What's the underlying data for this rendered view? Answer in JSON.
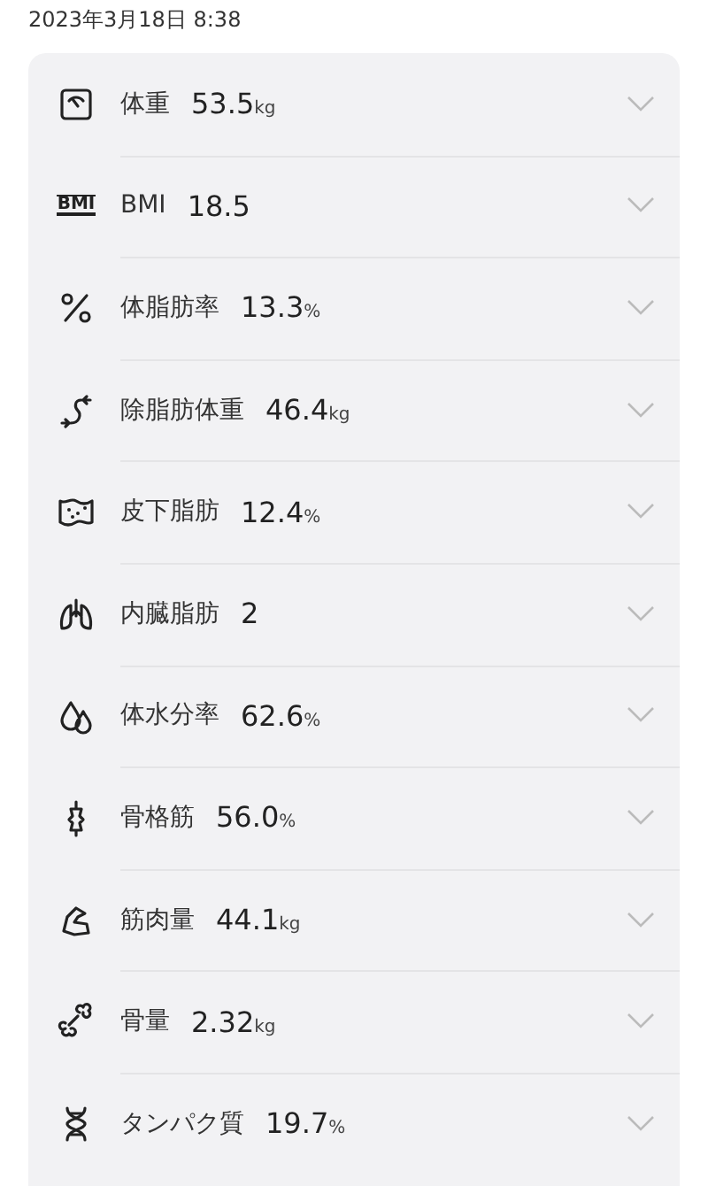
{
  "timestamp": "2023年3月18日 8:38",
  "metrics": [
    {
      "label": "体重",
      "value": "53.5",
      "unit": "kg",
      "expanded": false
    },
    {
      "label": "BMI",
      "value": "18.5",
      "icon_text": "BMI",
      "expanded": false
    },
    {
      "label": "体脂肪率",
      "value": "13.3",
      "unit": "%",
      "expanded": false
    },
    {
      "label": "除脂肪体重",
      "value": "46.4",
      "unit": "kg",
      "expanded": false
    },
    {
      "label": "皮下脂肪",
      "value": "12.4",
      "unit": "%",
      "expanded": false
    },
    {
      "label": "内臓脂肪",
      "value": "2",
      "expanded": false
    },
    {
      "label": "体水分率",
      "value": "62.6",
      "unit": "%",
      "expanded": false
    },
    {
      "label": "骨格筋",
      "value": "56.0",
      "unit": "%",
      "expanded": false
    },
    {
      "label": "筋肉量",
      "value": "44.1",
      "unit": "kg",
      "expanded": false
    },
    {
      "label": "骨量",
      "value": "2.32",
      "unit": "kg",
      "expanded": false
    },
    {
      "label": "タンパク質",
      "value": "19.7",
      "unit": "%",
      "expanded": false
    }
  ]
}
